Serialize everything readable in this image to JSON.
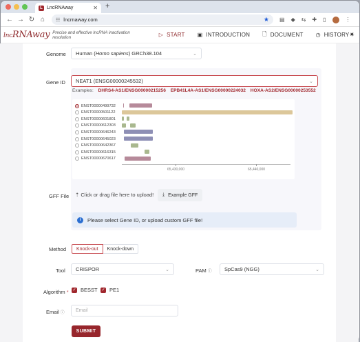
{
  "browser": {
    "tab_title": "LncRNAway",
    "tab_favicon": "L",
    "url": "lncrnaway.com"
  },
  "header": {
    "logo_prefix": "lnc",
    "logo_main": "RNAway",
    "tagline": "Precise and effective lncRNA inactivation resolution",
    "nav": [
      {
        "label": "START",
        "icon": "play-icon"
      },
      {
        "label": "INTRODUCTION",
        "icon": "book-icon"
      },
      {
        "label": "DOCUMENT",
        "icon": "document-icon"
      },
      {
        "label": "HISTORY",
        "icon": "history-icon"
      }
    ]
  },
  "form": {
    "genome_label": "Genome",
    "genome_value_pre": "Human (",
    "genome_value_species": "Homo sapiens",
    "genome_value_post": ") GRCh38.104",
    "gene_id_label": "Gene ID",
    "gene_id_value": "NEAT1 (ENSG00000245532)",
    "examples_label": "Examples:",
    "examples": [
      "DHRS4-AS1/ENSG00000215256",
      "EPB41L4A-AS1/ENSG00000224032",
      "HOXA-AS2/ENSG00000253552"
    ],
    "transcripts": [
      {
        "id": "ENST00000499732",
        "selected": true
      },
      {
        "id": "ENST00000501122",
        "selected": false
      },
      {
        "id": "ENST00000601801",
        "selected": false
      },
      {
        "id": "ENST00000612303",
        "selected": false
      },
      {
        "id": "ENST00000646243",
        "selected": false
      },
      {
        "id": "ENST00000645023",
        "selected": false
      },
      {
        "id": "ENST00000642367",
        "selected": false
      },
      {
        "id": "ENST00000616315",
        "selected": false
      },
      {
        "id": "ENST00000670617",
        "selected": false
      }
    ],
    "axis_ticks": [
      "65,430,000",
      "65,440,000"
    ],
    "gff_label": "GFF File",
    "upload_text": "Click or drag file here to upload!",
    "example_gff_label": "Example GFF",
    "info_text": "Please select Gene ID, or upload custom GFF file!",
    "method_label": "Method",
    "method_options": [
      "Knock-out",
      "Knock-down"
    ],
    "tool_label": "Tool",
    "tool_value": "CRISPOR",
    "pam_label": "PAM",
    "pam_value": "SpCas9 (NGG)",
    "algorithm_label": "Algorithm",
    "algorithm_required": "*",
    "algorithms": [
      "BESST",
      "PE1"
    ],
    "email_label": "Email",
    "email_placeholder": "Email",
    "submit_label": "SUBMIT"
  },
  "colors": {
    "brand": "#a0272d",
    "track_tan": "#dcc79a",
    "track_mauve": "#b68a9a",
    "track_purple": "#8e8fb5",
    "track_green": "#a9b88f",
    "info_bg": "#e6edf8"
  }
}
